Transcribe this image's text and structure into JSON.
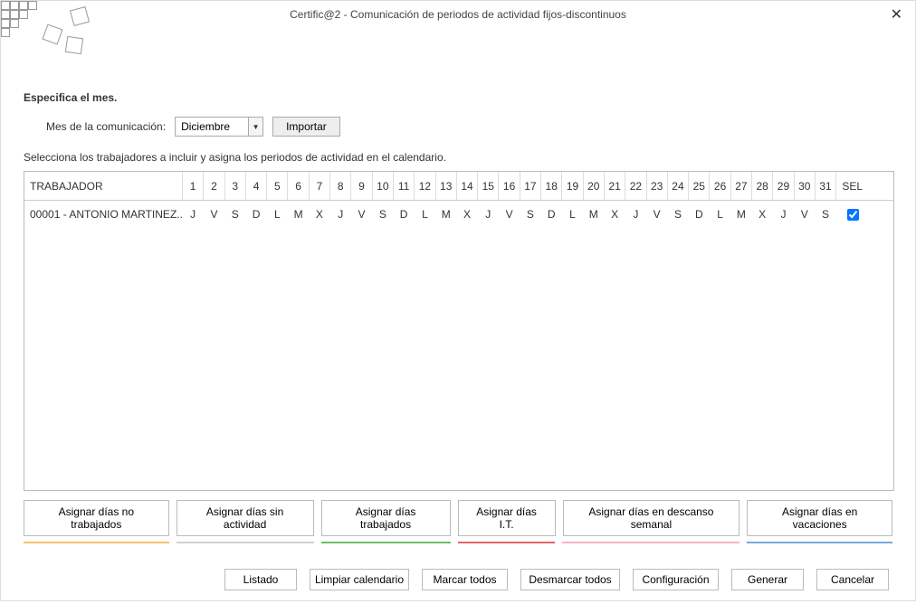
{
  "window": {
    "title": "Certific@2 - Comunicación de periodos de actividad fijos-discontinuos"
  },
  "labels": {
    "specify_month": "Especifica el mes.",
    "month_label": "Mes de la comunicación:",
    "import_button": "Importar",
    "instruction": "Selecciona los trabajadores a incluir y asigna los periodos de actividad en el calendario."
  },
  "month": {
    "value": "Diciembre"
  },
  "table": {
    "col_worker": "TRABAJADOR",
    "col_sel": "SEL",
    "days": [
      "1",
      "2",
      "3",
      "4",
      "5",
      "6",
      "7",
      "8",
      "9",
      "10",
      "11",
      "12",
      "13",
      "14",
      "15",
      "16",
      "17",
      "18",
      "19",
      "20",
      "21",
      "22",
      "23",
      "24",
      "25",
      "26",
      "27",
      "28",
      "29",
      "30",
      "31"
    ],
    "rows": [
      {
        "worker": "00001 - ANTONIO MARTINEZ...",
        "cells": [
          "J",
          "V",
          "S",
          "D",
          "L",
          "M",
          "X",
          "J",
          "V",
          "S",
          "D",
          "L",
          "M",
          "X",
          "J",
          "V",
          "S",
          "D",
          "L",
          "M",
          "X",
          "J",
          "V",
          "S",
          "D",
          "L",
          "M",
          "X",
          "J",
          "V",
          "S"
        ],
        "selected": true
      }
    ]
  },
  "assign": {
    "no_trabajados": "Asignar días no trabajados",
    "sin_actividad": "Asignar días sin actividad",
    "trabajados": "Asignar días trabajados",
    "it": "Asignar días I.T.",
    "descanso": "Asignar días en descanso semanal",
    "vacaciones": "Asignar días en vacaciones"
  },
  "buttons": {
    "listado": "Listado",
    "limpiar": "Limpiar calendario",
    "marcar": "Marcar todos",
    "desmarcar": "Desmarcar todos",
    "config": "Configuración",
    "generar": "Generar",
    "cancelar": "Cancelar"
  }
}
